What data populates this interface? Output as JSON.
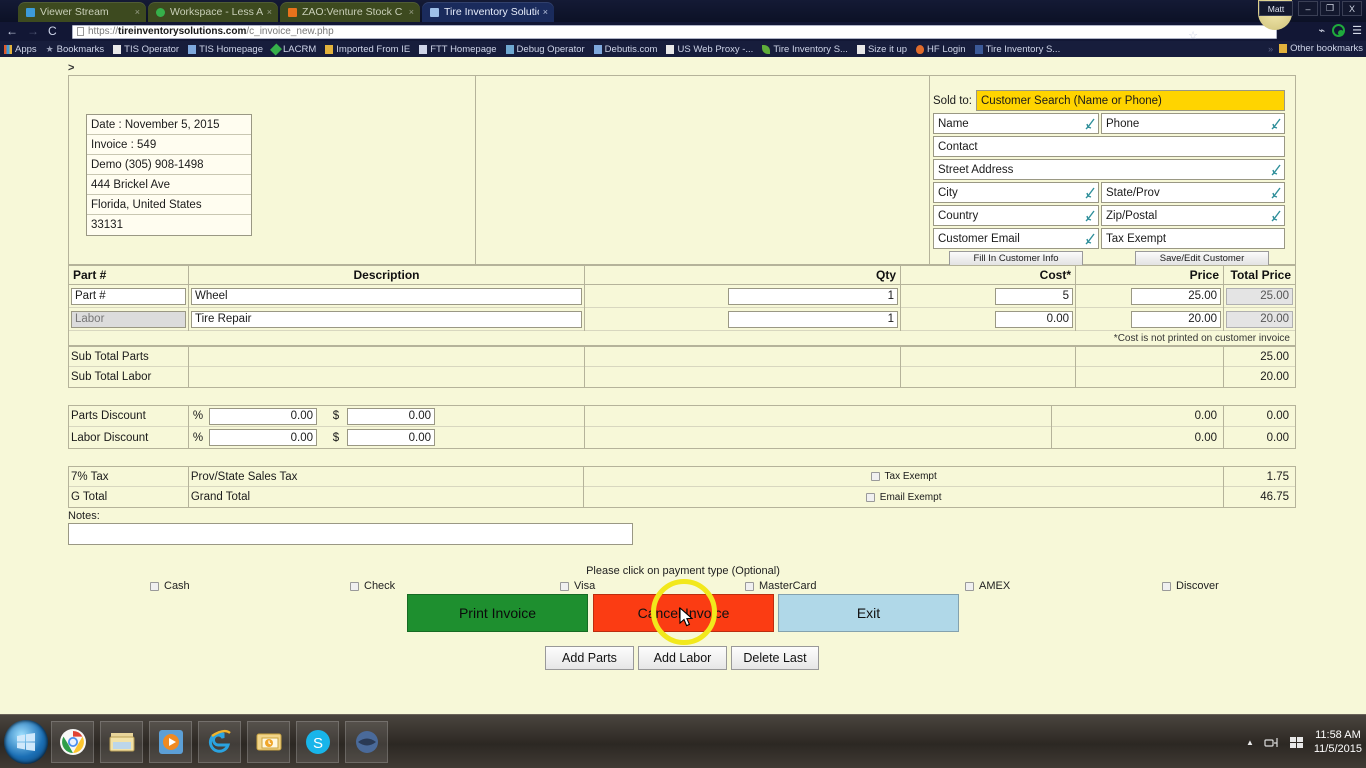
{
  "browser": {
    "tabs": [
      {
        "label": "Viewer Stream",
        "favicon_color": "#3d9bd9",
        "active": false
      },
      {
        "label": "Workspace - Less An",
        "favicon_color": "#36b04a",
        "active": false
      },
      {
        "label": "ZAO:Venture Stock C",
        "favicon_color": "#e8721c",
        "active": false
      },
      {
        "label": "Tire Inventory Solutio",
        "favicon_color": "#3a7ad0",
        "active": true
      }
    ],
    "tab_close_glyph": "×",
    "user_chip": "Matt",
    "window_controls": [
      "–",
      "❐",
      "X"
    ],
    "nav": {
      "back_icon": "←",
      "forward_icon": "→",
      "reload_icon": "C",
      "url_prefix": "https://",
      "url_domain": "tireinventorysolutions.com",
      "url_path": "/c_invoice_new.php",
      "star_icon": "☆"
    },
    "bookmarks": [
      {
        "label": "Apps",
        "icon_color": "#e05a2b"
      },
      {
        "label": "Bookmarks",
        "icon_color": "#9aa0b8"
      },
      {
        "label": "TIS Operator",
        "icon_color": "#e8e8e8"
      },
      {
        "label": "TIS Homepage",
        "icon_color": "#7ea8dd"
      },
      {
        "label": "LACRM",
        "icon_color": "#36b04a"
      },
      {
        "label": "Imported From IE",
        "icon_color": "#e2b23c"
      },
      {
        "label": "FTT Homepage",
        "icon_color": "#cfd5e8"
      },
      {
        "label": "Debug Operator",
        "icon_color": "#6fa8d0"
      },
      {
        "label": "Debutis.com",
        "icon_color": "#7ea8dd"
      },
      {
        "label": "US Web Proxy -...",
        "icon_color": "#e8e8e8"
      },
      {
        "label": "Tire Inventory S...",
        "icon_color": "#5fae3a"
      },
      {
        "label": "Size it up",
        "icon_color": "#e8e8e8"
      },
      {
        "label": "HF Login",
        "icon_color": "#e06b2b"
      },
      {
        "label": "Tire Inventory S...",
        "icon_color": "#3b5998"
      }
    ],
    "bookmark_overflow": "»",
    "other_bookmarks": {
      "label": "Other bookmarks",
      "icon_color": "#e2b23c"
    }
  },
  "invoice": {
    "prompt_symbol": ">",
    "company": [
      "Date : November 5, 2015",
      "Invoice : 549",
      "Demo  (305) 908-1498",
      "444 Brickel Ave",
      "Florida, United States",
      "33131"
    ],
    "sold_to": {
      "label": "Sold to:",
      "search_placeholder": "Customer Search (Name or Phone)",
      "fields": {
        "name": "Name",
        "phone": "Phone",
        "contact": "Contact",
        "street_address": "Street Address",
        "city": "City",
        "state_prov": "State/Prov",
        "country": "Country",
        "zip_postal": "Zip/Postal",
        "customer_email": "Customer Email",
        "tax_exempt": "Tax Exempt"
      },
      "fill_button": "Fill In Customer Info",
      "save_button": "Save/Edit Customer"
    },
    "table": {
      "headers": {
        "part": "Part #",
        "description": "Description",
        "qty": "Qty",
        "cost": "Cost*",
        "price": "Price",
        "total_price": "Total Price"
      },
      "rows": [
        {
          "part": "Part #",
          "part_readonly": false,
          "description": "Wheel",
          "qty": "1",
          "cost": "5",
          "price": "25.00",
          "total": "25.00"
        },
        {
          "part": "Labor",
          "part_readonly": true,
          "description": "Tire Repair",
          "qty": "1",
          "cost": "0.00",
          "price": "20.00",
          "total": "20.00"
        }
      ],
      "cost_note": "*Cost is not printed on customer invoice",
      "subtotals": [
        {
          "label": "Sub Total Parts",
          "total": "25.00"
        },
        {
          "label": "Sub Total Labor",
          "total": "20.00"
        }
      ]
    },
    "discounts": [
      {
        "label": "Parts Discount",
        "pct_symbol": "%",
        "pct_value": "0.00",
        "amt_symbol": "$",
        "amt_value": "0.00",
        "col5": "0.00",
        "col6": "0.00"
      },
      {
        "label": "Labor Discount",
        "pct_symbol": "%",
        "pct_value": "0.00",
        "amt_symbol": "$",
        "amt_value": "0.00",
        "col5": "0.00",
        "col6": "0.00"
      }
    ],
    "totals": [
      {
        "label": "7% Tax",
        "description": "Prov/State Sales Tax",
        "checkbox_label": "Tax Exempt",
        "value": "1.75"
      },
      {
        "label": "G Total",
        "description": "Grand Total",
        "checkbox_label": "Email Exempt",
        "value": "46.75"
      }
    ],
    "notes_label": "Notes:",
    "notes_value": "",
    "payment_prompt": "Please click on payment type (Optional)",
    "payment_types": [
      "Cash",
      "Check",
      "Visa",
      "MasterCard",
      "AMEX",
      "Discover"
    ],
    "actions": {
      "print": "Print Invoice",
      "cancel": "Cancel Invoice",
      "exit": "Exit",
      "add_parts": "Add Parts",
      "add_labor": "Add Labor",
      "delete_last": "Delete Last"
    },
    "colors": {
      "page_bg": "#f7f8d8",
      "search_highlight": "#ffd400",
      "print_button": "#1e8f2f",
      "cancel_button": "#fb3c13",
      "exit_button": "#b0d8e8",
      "highlight_ring": "#f2e81c"
    }
  },
  "taskbar": {
    "start_label": "Start",
    "items": [
      "chrome",
      "file-explorer",
      "media-player",
      "internet-explorer",
      "outlook",
      "skype",
      "app"
    ],
    "tray": {
      "overflow_icon": "▲",
      "network_icon": "network",
      "action_center_icon": "windows",
      "time": "11:58 AM",
      "date": "11/5/2015"
    }
  }
}
